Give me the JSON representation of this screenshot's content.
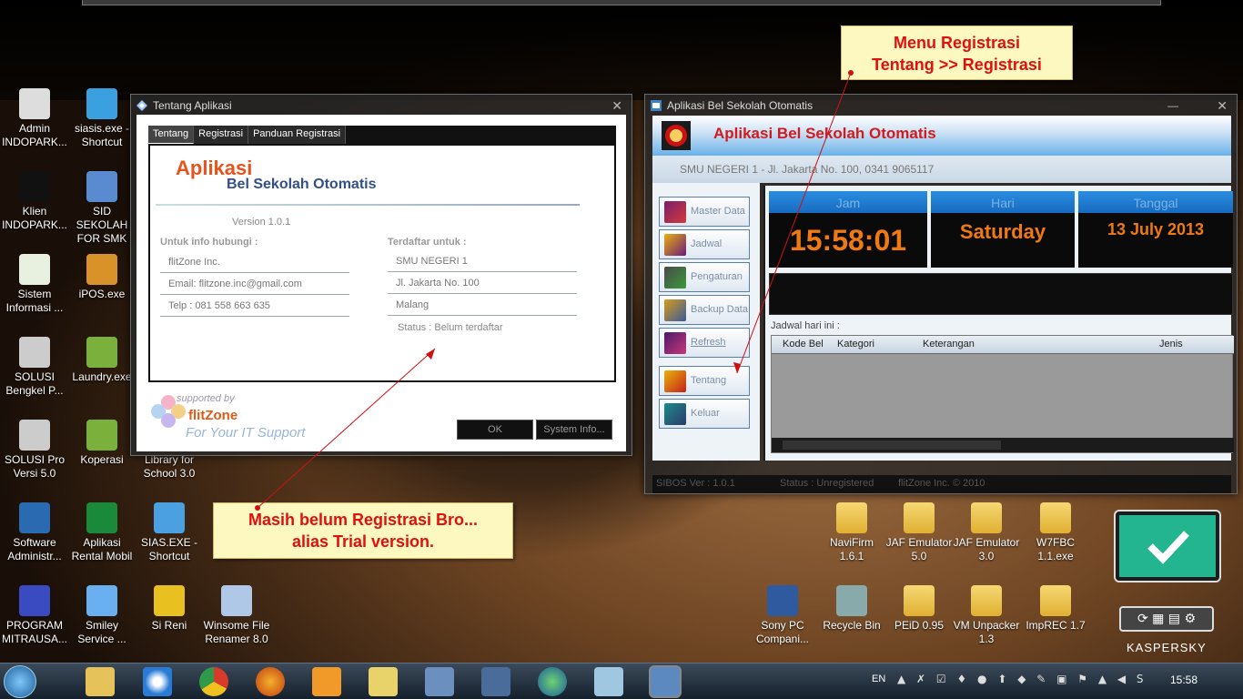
{
  "desktop_icons_left": [
    {
      "label": "Admin INDOPARK...",
      "icon": "admin-icon"
    },
    {
      "label": "siasis.exe - Shortcut",
      "icon": "cube-icon"
    },
    {
      "label": "Klien INDOPARK...",
      "icon": "p-letter-icon"
    },
    {
      "label": "SID SEKOLAH FOR SMK",
      "icon": "monitor-icon"
    },
    {
      "label": "Sistem Informasi ...",
      "icon": "checklist-icon"
    },
    {
      "label": "iPOS.exe",
      "icon": "briefcase-icon"
    },
    {
      "label": "SOLUSI Bengkel P...",
      "icon": "cash-register-icon"
    },
    {
      "label": "Laundry.exe",
      "icon": "spreadsheet-icon"
    },
    {
      "label": "SOLUSI Pro Versi 5.0",
      "icon": "cash-register-icon"
    },
    {
      "label": "Koperasi",
      "icon": "spreadsheet-icon"
    },
    {
      "label": "Library for School 3.0",
      "icon": "book-icon"
    },
    {
      "label": "Software Administr...",
      "icon": "software-box-icon"
    },
    {
      "label": "Aplikasi Rental Mobil",
      "icon": "letter-a-icon"
    },
    {
      "label": "SIAS.EXE - Shortcut",
      "icon": "satellite-icon"
    },
    {
      "label": "PROGRAM MITRAUSA...",
      "icon": "program-icon"
    },
    {
      "label": "Smiley Service ...",
      "icon": "phone-icon"
    },
    {
      "label": "Si Reni",
      "icon": "handshake-icon"
    },
    {
      "label": "Winsome File Renamer 8.0",
      "icon": "file-rename-icon"
    }
  ],
  "desktop_icons_right": [
    {
      "label": "NaviFirm 1.6.1"
    },
    {
      "label": "JAF Emulator 5.0"
    },
    {
      "label": "JAF Emulator 3.0"
    },
    {
      "label": "W7FBC 1.1.exe"
    },
    {
      "label": "Sony PC Compani..."
    },
    {
      "label": "Recycle Bin"
    },
    {
      "label": "PEiD 0.95"
    },
    {
      "label": "VM Unpacker 1.3"
    },
    {
      "label": "ImpREC 1.7"
    }
  ],
  "about_window": {
    "title": "Tentang Aplikasi",
    "tabs": [
      "Tentang",
      "Registrasi",
      "Panduan Registrasi"
    ],
    "app_title_1": "Aplikasi",
    "app_title_2": "Bel Sekolah Otomatis",
    "version": "Version 1.0.1",
    "contact_label": "Untuk info hubungi :",
    "contact": [
      "flitZone Inc.",
      "Email: flitzone.inc@gmail.com",
      "Telp : 081 558 663 635"
    ],
    "registered_label": "Terdaftar untuk :",
    "registered": [
      "SMU NEGERI 1",
      "Jl. Jakarta No. 100",
      "Malang"
    ],
    "status": "Status : Belum terdaftar",
    "supported_by": "supported by",
    "brand": "flitZone",
    "tagline": "For Your IT Support",
    "ok_button": "OK",
    "sysinfo_button": "System Info..."
  },
  "main_window": {
    "title": "Aplikasi Bel Sekolah Otomatis",
    "header_title": "Aplikasi Bel Sekolah Otomatis",
    "address": "SMU NEGERI 1  -  Jl. Jakarta No. 100, 0341 9065117",
    "menu": [
      "Master Data",
      "Jadwal",
      "Pengaturan",
      "Backup Data",
      "Refresh",
      "Tentang",
      "Keluar"
    ],
    "clock_headers": [
      "Jam",
      "Hari",
      "Tanggal"
    ],
    "time": "15:58:01",
    "day": "Saturday",
    "date": "13 July 2013",
    "schedule_label": "Jadwal hari ini :",
    "table_headers": [
      "Kode Bel",
      "Kategori",
      "Keterangan",
      "Jenis"
    ],
    "status_bar": [
      "SIBOS Ver : 1.0.1",
      "Status : Unregistered",
      "flitZone Inc. © 2010"
    ]
  },
  "callouts": {
    "top_line1": "Menu Registrasi",
    "top_line2": "Tentang >> Registrasi",
    "bottom_line1": "Masih belum Registrasi Bro...",
    "bottom_line2": "alias Trial version."
  },
  "tray": {
    "lang": "EN",
    "time": "15:58"
  },
  "kaspersky": "KASPERSKY",
  "colors": {
    "callout_text": "#e01010",
    "clock_digits": "#f07a12",
    "accent_blue": "#2b8de0"
  }
}
